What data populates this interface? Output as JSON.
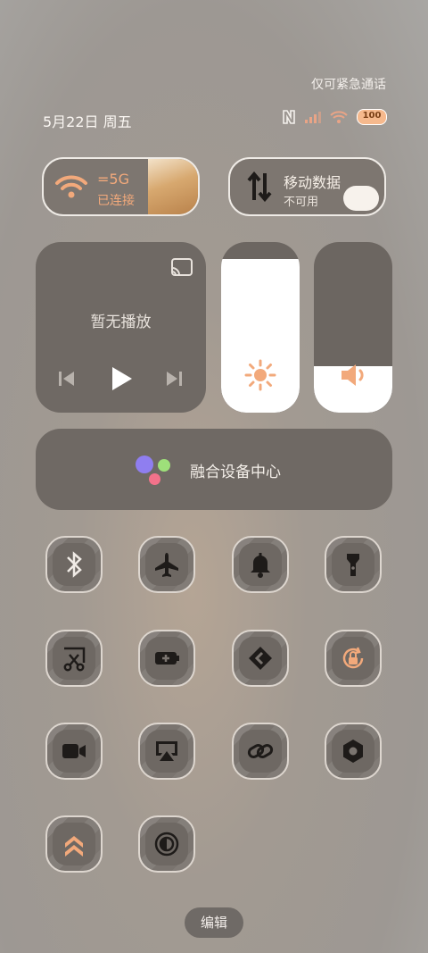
{
  "statusbar": {
    "notice": "仅可紧急通话",
    "date": "5月22日 周五",
    "battery_label": "100"
  },
  "tiles": {
    "wifi": {
      "name": "=5G",
      "sub": "已连接"
    },
    "mobile": {
      "name": "移动数据",
      "sub": "不可用"
    }
  },
  "media": {
    "title": "暂无播放"
  },
  "sliders": {
    "brightness_level": 0.9,
    "volume_level": 0.27
  },
  "fusion": {
    "label": "融合设备中心"
  },
  "toggles": [
    {
      "icon": "bluetooth-icon"
    },
    {
      "icon": "airplane-icon"
    },
    {
      "icon": "bell-icon"
    },
    {
      "icon": "flashlight-icon"
    },
    {
      "icon": "screenshot-scissors-icon"
    },
    {
      "icon": "battery-saver-icon"
    },
    {
      "icon": "share-arrow-icon"
    },
    {
      "icon": "rotation-lock-icon"
    },
    {
      "icon": "screen-record-icon"
    },
    {
      "icon": "screen-cast-icon"
    },
    {
      "icon": "link-icon"
    },
    {
      "icon": "hex-nut-icon"
    },
    {
      "icon": "chevrons-up-icon"
    },
    {
      "icon": "dark-mode-icon"
    }
  ],
  "edit_label": "编辑",
  "colors": {
    "accent": "#f2a97b",
    "tile_bg": "#6f6964"
  }
}
